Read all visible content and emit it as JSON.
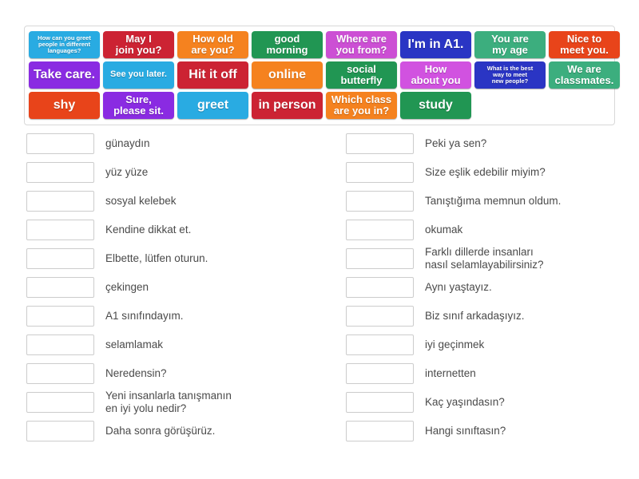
{
  "tile_bank": {
    "rows": [
      [
        {
          "text": "How can you greet\npeople in different\nlanguages?",
          "color": "#29ABE2",
          "size": "xs",
          "name": "tile-greet-languages"
        },
        {
          "text": "May I\njoin you?",
          "color": "#CC2333",
          "size": "md",
          "name": "tile-may-i-join-you"
        },
        {
          "text": "How old\nare you?",
          "color": "#F5821F",
          "size": "md",
          "name": "tile-how-old-are-you"
        },
        {
          "text": "good\nmorning",
          "color": "#219653",
          "size": "md",
          "name": "tile-good-morning"
        },
        {
          "text": "Where are\nyou from?",
          "color": "#CC4FD4",
          "size": "md",
          "name": "tile-where-are-you-from"
        },
        {
          "text": "I'm in A1.",
          "color": "#2A35C4",
          "size": "lg",
          "name": "tile-im-in-a1"
        },
        {
          "text": "You are\nmy age",
          "color": "#3CAE7E",
          "size": "md",
          "name": "tile-you-are-my-age"
        },
        {
          "text": "Nice to\nmeet you.",
          "color": "#E8441A",
          "size": "md",
          "name": "tile-nice-to-meet-you"
        }
      ],
      [
        {
          "text": "Take care.",
          "color": "#8A2BE2",
          "size": "lg",
          "name": "tile-take-care"
        },
        {
          "text": "See you later.",
          "color": "#29ABE2",
          "size": "sm",
          "name": "tile-see-you-later"
        },
        {
          "text": "Hit it off",
          "color": "#CC2333",
          "size": "lg",
          "name": "tile-hit-it-off"
        },
        {
          "text": "online",
          "color": "#F5821F",
          "size": "lg",
          "name": "tile-online"
        },
        {
          "text": "social\nbutterfly",
          "color": "#219653",
          "size": "md",
          "name": "tile-social-butterfly"
        },
        {
          "text": "How\nabout you",
          "color": "#D152E0",
          "size": "md",
          "name": "tile-how-about-you"
        },
        {
          "text": "What is the best\nway to meet\nnew people?",
          "color": "#2A35C4",
          "size": "xs",
          "name": "tile-best-way-meet-people"
        },
        {
          "text": "We are\nclassmates.",
          "color": "#3CAE7E",
          "size": "md",
          "name": "tile-we-are-classmates"
        }
      ],
      [
        {
          "text": "shy",
          "color": "#E8441A",
          "size": "lg",
          "name": "tile-shy"
        },
        {
          "text": "Sure,\nplease sit.",
          "color": "#8A2BE2",
          "size": "md",
          "name": "tile-sure-please-sit"
        },
        {
          "text": "greet",
          "color": "#29ABE2",
          "size": "lg",
          "name": "tile-greet"
        },
        {
          "text": "in person",
          "color": "#CC2333",
          "size": "lg",
          "name": "tile-in-person"
        },
        {
          "text": "Which class\nare you in?",
          "color": "#F5821F",
          "size": "md",
          "name": "tile-which-class-are-you-in"
        },
        {
          "text": "study",
          "color": "#219653",
          "size": "lg",
          "name": "tile-study"
        }
      ]
    ]
  },
  "left_column": [
    {
      "label": "günaydın"
    },
    {
      "label": "yüz yüze"
    },
    {
      "label": "sosyal kelebek"
    },
    {
      "label": "Kendine dikkat et."
    },
    {
      "label": "Elbette, lütfen oturun."
    },
    {
      "label": "çekingen"
    },
    {
      "label": "A1 sınıfındayım."
    },
    {
      "label": "selamlamak"
    },
    {
      "label": "Neredensin?"
    },
    {
      "label": "Yeni insanlarla tanışmanın\nen iyi yolu nedir?"
    },
    {
      "label": "Daha sonra görüşürüz."
    }
  ],
  "right_column": [
    {
      "label": "Peki ya sen?"
    },
    {
      "label": "Size eşlik edebilir miyim?"
    },
    {
      "label": "Tanıştığıma memnun oldum."
    },
    {
      "label": "okumak"
    },
    {
      "label": "Farklı dillerde insanları\nnasıl selamlayabilirsiniz?"
    },
    {
      "label": "Aynı yaştayız."
    },
    {
      "label": "Biz sınıf arkadaşıyız."
    },
    {
      "label": "iyi geçinmek"
    },
    {
      "label": "internetten"
    },
    {
      "label": "Kaç yaşındasın?"
    },
    {
      "label": "Hangi sınıftasın?"
    }
  ]
}
